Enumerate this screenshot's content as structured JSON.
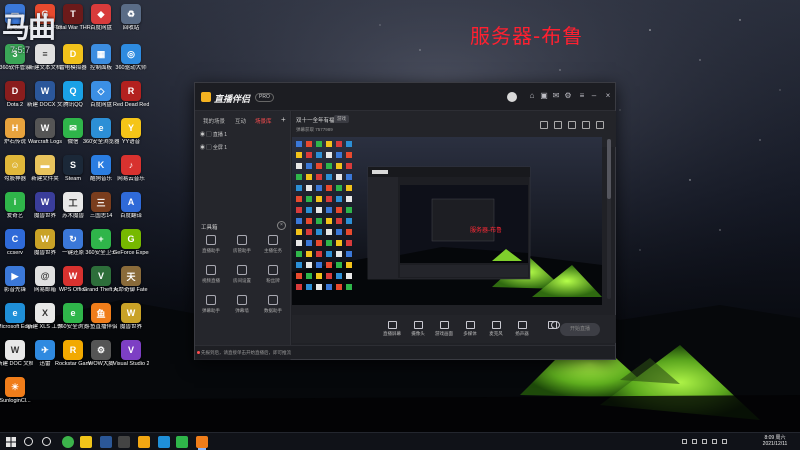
{
  "overlay": {
    "logo_text": "马曲",
    "logo_sub": "7:5:7",
    "server_label": "服务器-布鲁"
  },
  "desktop_icons": [
    {
      "label": "此电脑",
      "color": "#3b78d8",
      "glyph": "▭"
    },
    {
      "label": "超级游戏平台",
      "color": "#e84a2e",
      "glyph": "G"
    },
    {
      "label": "Total War THREE KI...",
      "color": "#6b1a1a",
      "glyph": "T"
    },
    {
      "label": "百度网盘",
      "color": "#d83b3b",
      "glyph": "◆"
    },
    {
      "label": "回收站",
      "color": "#5a6c86",
      "glyph": "♻"
    },
    {
      "label": "360软件管家",
      "color": "#3aa657",
      "glyph": "3"
    },
    {
      "label": "新建文本文档",
      "color": "#e0e0e0",
      "glyph": "≡"
    },
    {
      "label": "雷电模拟器",
      "color": "#f2c21b",
      "glyph": "D"
    },
    {
      "label": "控制面板",
      "color": "#3c8de0",
      "glyph": "▦"
    },
    {
      "label": "360驱动大师",
      "color": "#2e8be0",
      "glyph": "◎"
    },
    {
      "label": "Dota 2",
      "color": "#8a1d1d",
      "glyph": "D"
    },
    {
      "label": "新建 DOCX 文档",
      "color": "#2b579a",
      "glyph": "W"
    },
    {
      "label": "腾讯QQ",
      "color": "#1aa1e6",
      "glyph": "Q"
    },
    {
      "label": "百度网盘",
      "color": "#3b8fe5",
      "glyph": "◇"
    },
    {
      "label": "Red Dead Redemption",
      "color": "#b3211f",
      "glyph": "R"
    },
    {
      "label": "炉石传说",
      "color": "#e8a33d",
      "glyph": "H"
    },
    {
      "label": "Warcraft Logs",
      "color": "#555",
      "glyph": "W"
    },
    {
      "label": "微信",
      "color": "#2fb54a",
      "glyph": "✉"
    },
    {
      "label": "360安全浏览器",
      "color": "#2c8fd6",
      "glyph": "e"
    },
    {
      "label": "YY语音",
      "color": "#f5c518",
      "glyph": "Y"
    },
    {
      "label": "勾股神器",
      "color": "#e0b73a",
      "glyph": "☺"
    },
    {
      "label": "新建文件夹",
      "color": "#e8c35c",
      "glyph": "▬"
    },
    {
      "label": "Steam",
      "color": "#1b2838",
      "glyph": "S"
    },
    {
      "label": "酷狗音乐",
      "color": "#2a7de1",
      "glyph": "K"
    },
    {
      "label": "网易云音乐",
      "color": "#d8322f",
      "glyph": "♪"
    },
    {
      "label": "爱奇艺",
      "color": "#2fb54a",
      "glyph": "i"
    },
    {
      "label": "魔兽世界",
      "color": "#3a3d9a",
      "glyph": "W"
    },
    {
      "label": "苏木魔兽",
      "color": "#e8e8e8",
      "glyph": "工"
    },
    {
      "label": "三国志14",
      "color": "#7a3d1d",
      "glyph": "三"
    },
    {
      "label": "百度翻译",
      "color": "#2f6ad8",
      "glyph": "A"
    },
    {
      "label": "ccserv",
      "color": "#2f6ad8",
      "glyph": "C"
    },
    {
      "label": "魔兽世界",
      "color": "#c9a227",
      "glyph": "W"
    },
    {
      "label": "一键还原",
      "color": "#3b78d8",
      "glyph": "↻"
    },
    {
      "label": "360安全卫士",
      "color": "#2fb54a",
      "glyph": "+"
    },
    {
      "label": "GeForce Experience",
      "color": "#76b900",
      "glyph": "G"
    },
    {
      "label": "影音先锋",
      "color": "#3b78d8",
      "glyph": "▶"
    },
    {
      "label": "网易邮箱",
      "color": "#e0e0e0",
      "glyph": "@"
    },
    {
      "label": "WPS Office",
      "color": "#d8322f",
      "glyph": "W"
    },
    {
      "label": "Grand Theft Auto V",
      "color": "#2d6e3a",
      "glyph": "V"
    },
    {
      "label": "天命奇御 Fate Seeker",
      "color": "#8a6b3a",
      "glyph": "天"
    },
    {
      "label": "Microsoft Edge",
      "color": "#1f8fd8",
      "glyph": "e"
    },
    {
      "label": "新建 XLS 工作表",
      "color": "#e8e8e8",
      "glyph": "X"
    },
    {
      "label": "360安全浏览",
      "color": "#2fb54a",
      "glyph": "e"
    },
    {
      "label": "斗鱼直播伴侣",
      "color": "#f07d1a",
      "glyph": "鱼"
    },
    {
      "label": "魔兽世界",
      "color": "#c9a227",
      "glyph": "W"
    },
    {
      "label": "新建 DOC 文档",
      "color": "#e8e8e8",
      "glyph": "W"
    },
    {
      "label": "迅雷",
      "color": "#2f8ae0",
      "glyph": "✈"
    },
    {
      "label": "Rockstar Games",
      "color": "#f2a900",
      "glyph": "R"
    },
    {
      "label": "WOW大脚",
      "color": "#555",
      "glyph": "⚙"
    },
    {
      "label": "Visual Studio 20...",
      "color": "#7d3fc4",
      "glyph": "V"
    },
    {
      "label": "SunloginCl...",
      "color": "#f07d1a",
      "glyph": "☀"
    }
  ],
  "app": {
    "title": "直播伴侣",
    "badge": "PRO",
    "sidebar_tabs": [
      "我的场景",
      "互动",
      "场景库"
    ],
    "scenes": [
      "直播 1",
      "全屏 1"
    ],
    "tool_title": "工具箱",
    "tools": [
      "直播助手",
      "房管助手",
      "主播任务",
      "视频直播",
      "房间设置",
      "粉丝牌",
      "弹幕助手",
      "弹幕墙",
      "数据助手"
    ],
    "room_title": "双十一全年有福利",
    "room_tag": "游戏",
    "room_sub": "弹幕获取 7577989",
    "bottom_tools": [
      "直播屏幕",
      "摄像头",
      "游戏画面",
      "多媒体",
      "麦克风",
      "扬声器"
    ],
    "start_live": "开始直播",
    "status_text": "先报到后，请直接单击开始直播后，即可推流"
  },
  "inner_preview": {
    "label": "服务器-布鲁"
  },
  "taskbar": {
    "time": "8:09 周六",
    "date": "2021/12/11"
  }
}
